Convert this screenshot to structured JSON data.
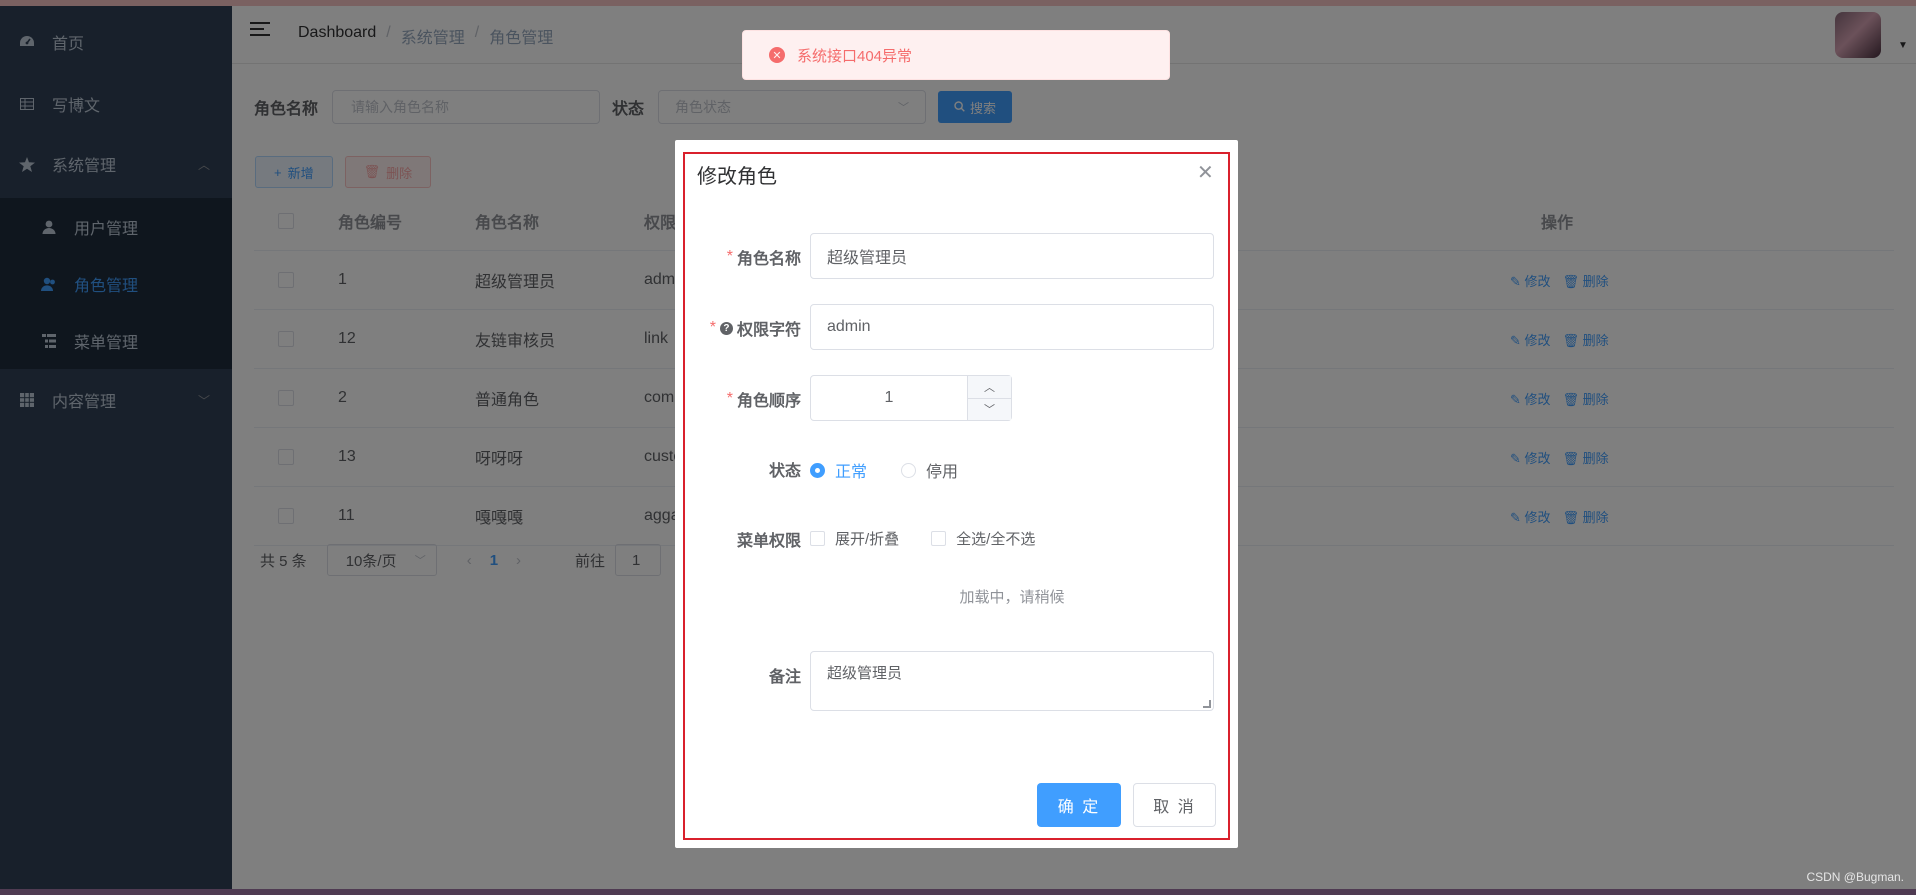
{
  "sidebar": {
    "items": [
      {
        "label": "首页",
        "icon": "dashboard-icon"
      },
      {
        "label": "写博文",
        "icon": "edit-grid-icon"
      },
      {
        "label": "系统管理",
        "icon": "star-icon"
      },
      {
        "label": "内容管理",
        "icon": "table-icon"
      }
    ],
    "sub_items": [
      {
        "label": "用户管理",
        "icon": "user-icon"
      },
      {
        "label": "角色管理",
        "icon": "peoples-icon"
      },
      {
        "label": "菜单管理",
        "icon": "tree-table-icon"
      }
    ]
  },
  "navbar": {
    "breadcrumb": [
      "Dashboard",
      "系统管理",
      "角色管理"
    ],
    "separator": "/"
  },
  "search": {
    "role_name_label": "角色名称",
    "role_name_placeholder": "请输入角色名称",
    "status_label": "状态",
    "status_placeholder": "角色状态",
    "search_button": "搜索"
  },
  "toolbar": {
    "add_label": "新增",
    "delete_label": "删除"
  },
  "table": {
    "columns": [
      "角色编号",
      "角色名称",
      "权限字",
      "操作"
    ],
    "rows": [
      {
        "id": "1",
        "name": "超级管理员",
        "key": "admin"
      },
      {
        "id": "12",
        "name": "友链审核员",
        "key": "link"
      },
      {
        "id": "2",
        "name": "普通角色",
        "key": "comm"
      },
      {
        "id": "13",
        "name": "呀呀呀",
        "key": "custo"
      },
      {
        "id": "11",
        "name": "嘎嘎嘎",
        "key": "aggag"
      }
    ],
    "edit_label": "修改",
    "delete_label": "删除"
  },
  "pagination": {
    "total": "共 5 条",
    "page_size": "10条/页",
    "current": "1",
    "goto_label": "前往",
    "goto_value": "1"
  },
  "toast": {
    "message": "系统接口404异常"
  },
  "dialog": {
    "title": "修改角色",
    "fields": {
      "role_name_label": "角色名称",
      "role_name_value": "超级管理员",
      "role_key_label": "权限字符",
      "role_key_value": "admin",
      "role_sort_label": "角色顺序",
      "role_sort_value": "1",
      "status_label": "状态",
      "status_options": [
        "正常",
        "停用"
      ],
      "status_selected": "正常",
      "menu_label": "菜单权限",
      "menu_expand": "展开/折叠",
      "menu_select_all": "全选/全不选",
      "menu_loading": "加载中，请稍候",
      "remark_label": "备注",
      "remark_value": "超级管理员"
    },
    "confirm": "确 定",
    "cancel": "取 消"
  },
  "watermark": "CSDN @Bugman.",
  "colors": {
    "primary": "#409eff",
    "sidebar_bg": "#304156",
    "danger": "#f56c6c",
    "highlight_frame": "#d9202c"
  }
}
